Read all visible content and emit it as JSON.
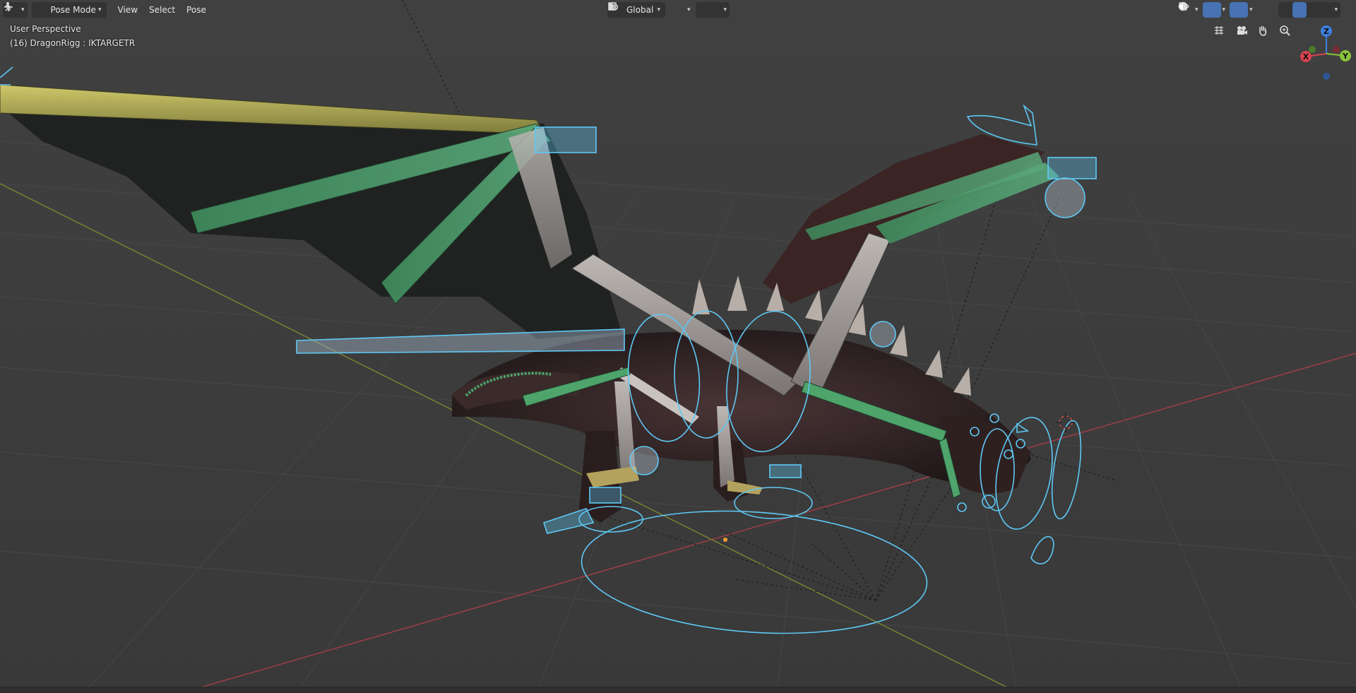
{
  "header": {
    "editor_type_icon": "transform-gizmo-icon",
    "mode": {
      "label": "Pose Mode",
      "icon": "pose-mode-icon"
    },
    "menus": [
      {
        "label": "View"
      },
      {
        "label": "Select"
      },
      {
        "label": "Pose"
      }
    ],
    "orientation": {
      "label": "Global",
      "icon": "orientation-icon"
    },
    "pivot_icon": "pivot-point-icon",
    "snap_icon": "snap-icon",
    "proportional_icon": "proportional-edit-icon",
    "right_icons": [
      "visibility-icon",
      "gizmo-icon",
      "overlay-icon",
      "xray-icon",
      "wireframe-shading-icon",
      "solid-shading-icon",
      "material-shading-icon",
      "rendered-shading-icon"
    ]
  },
  "overlay": {
    "view_name": "User Perspective",
    "object_info": "(16) DragonRigg : IKTARGETR"
  },
  "navigation": {
    "tools": [
      "grid-toggle-icon",
      "camera-view-icon",
      "pan-hand-icon",
      "zoom-icon"
    ],
    "gizmo_axes": {
      "x": "X",
      "y": "Y",
      "z": "Z"
    }
  },
  "colors": {
    "viewport_bg": "#3d3d3d",
    "selected_bone_outline": "#5ec8f5",
    "active_highlight": "#4772b3",
    "x_axis": "#d8424f",
    "y_axis": "#8ac33b",
    "z_axis": "#3d7fe0"
  }
}
